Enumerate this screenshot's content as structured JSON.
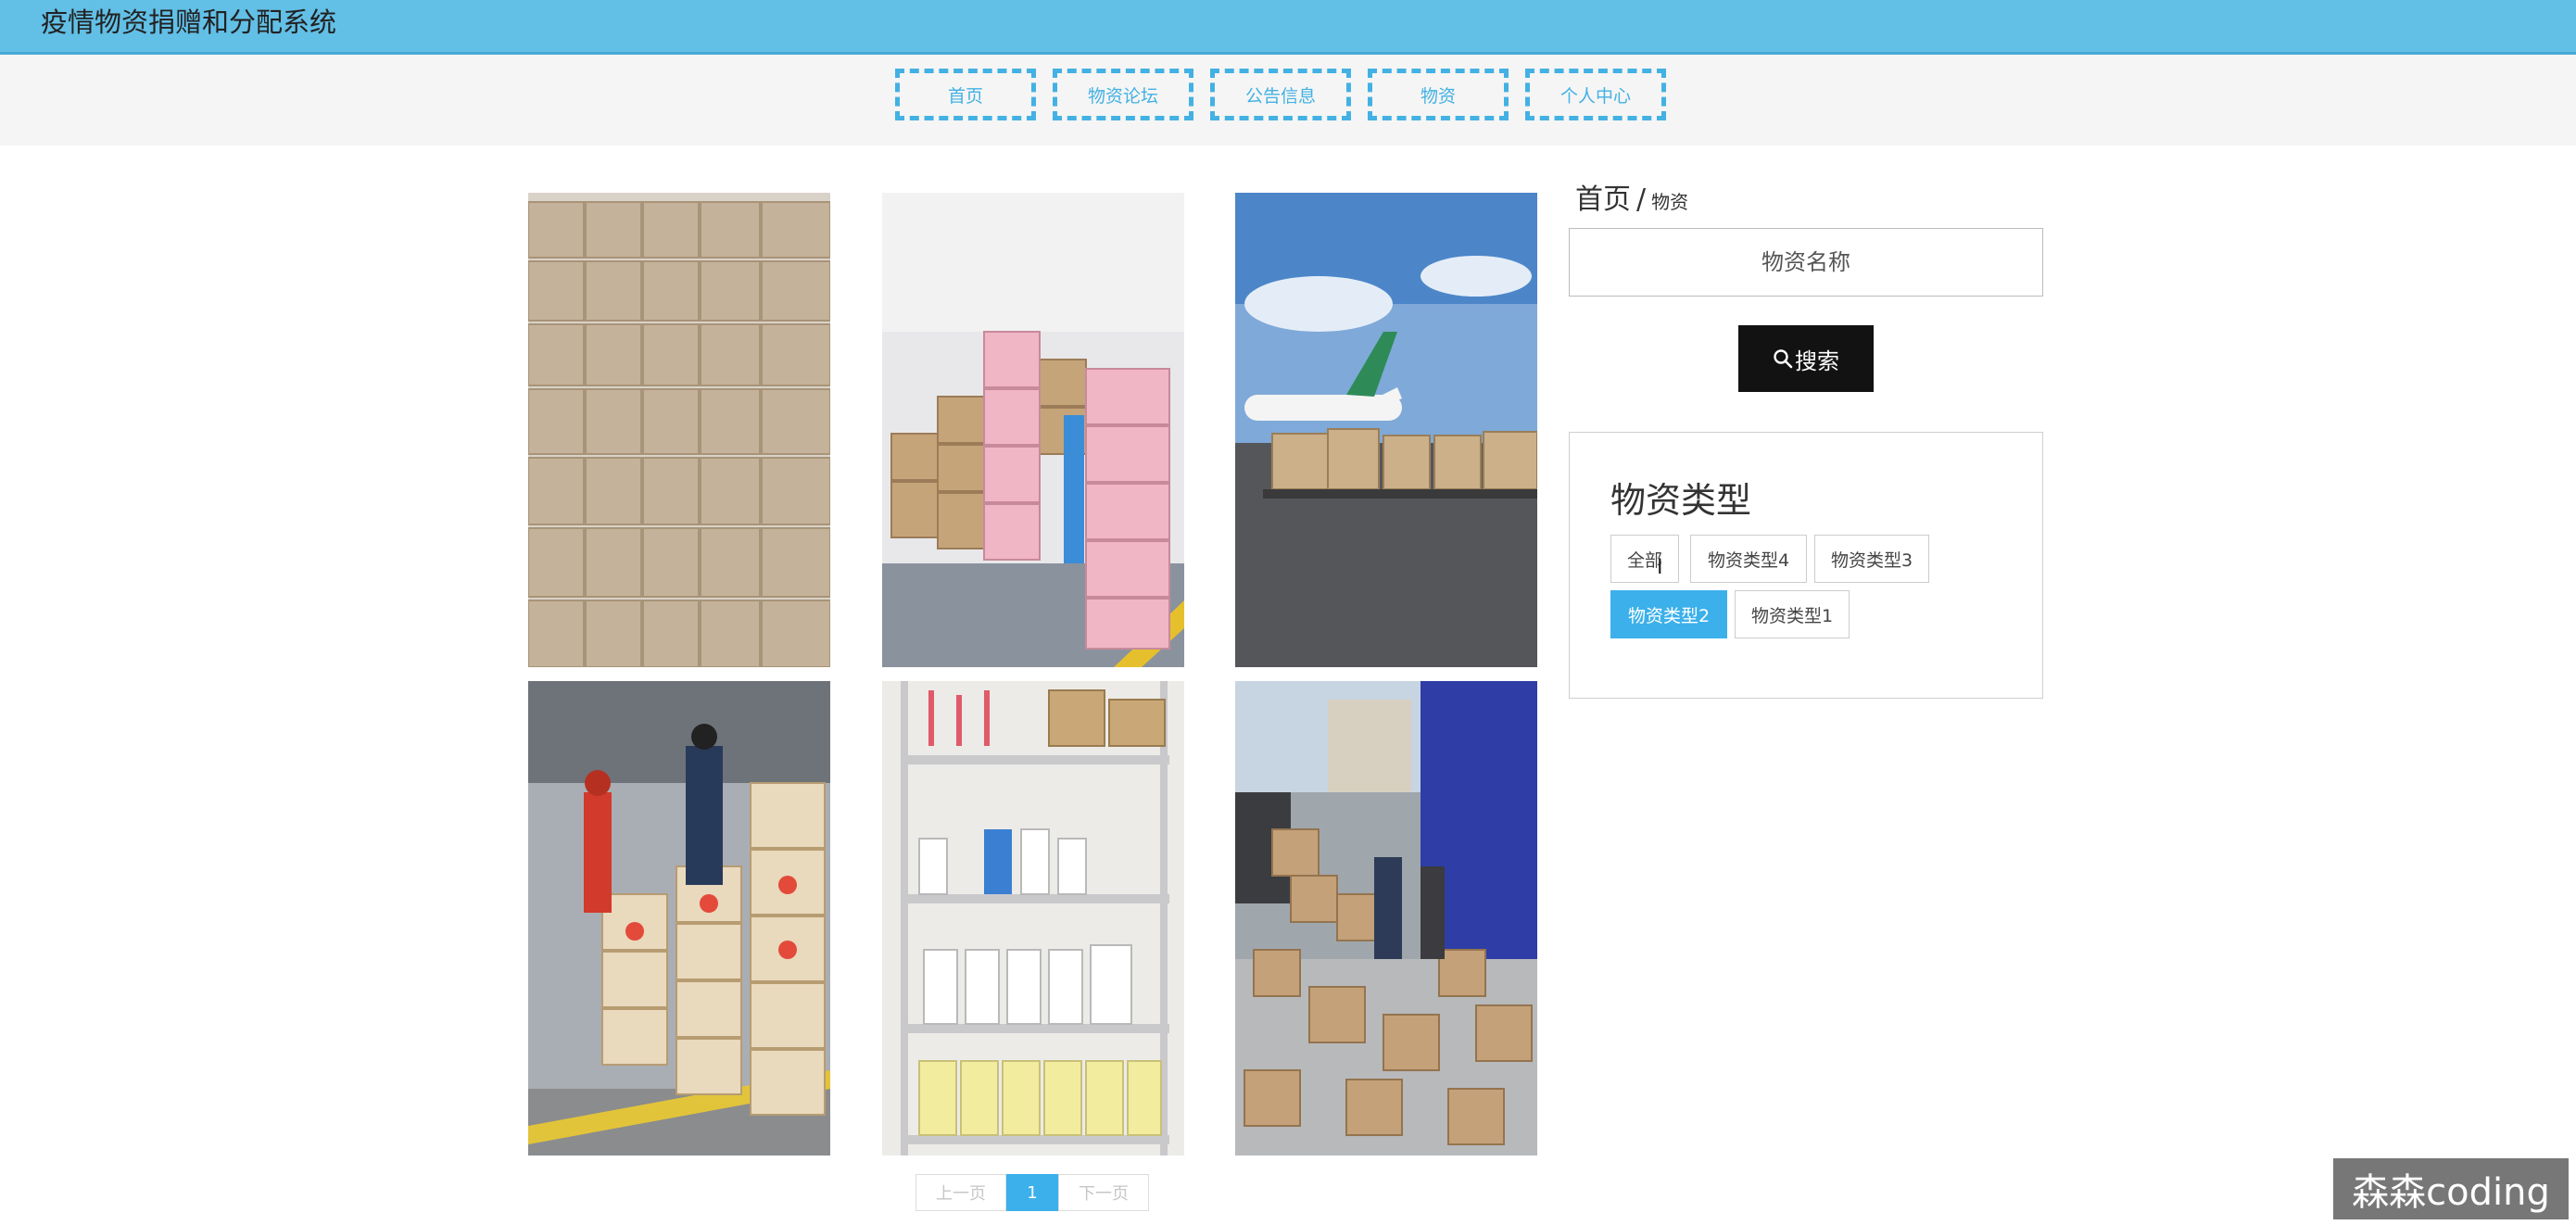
{
  "header": {
    "title": "疫情物资捐赠和分配系统"
  },
  "nav": [
    "首页",
    "物资论坛",
    "公告信息",
    "物资",
    "个人中心"
  ],
  "breadcrumb": {
    "home": "首页",
    "separator": "/",
    "current": "物资"
  },
  "search": {
    "placeholder": "物资名称",
    "button_label": "搜索"
  },
  "category": {
    "title": "物资类型",
    "chips": [
      "全部",
      "物资类型4",
      "物资类型3",
      "物资类型2",
      "物资类型1"
    ],
    "selected": "物资类型2"
  },
  "pagination": {
    "prev": "上一页",
    "current": "1",
    "next": "下一页"
  },
  "watermark": "森森coding",
  "colors": {
    "accent": "#3cb0ea",
    "topbar": "#62bfe6",
    "search_button": "#121212"
  }
}
